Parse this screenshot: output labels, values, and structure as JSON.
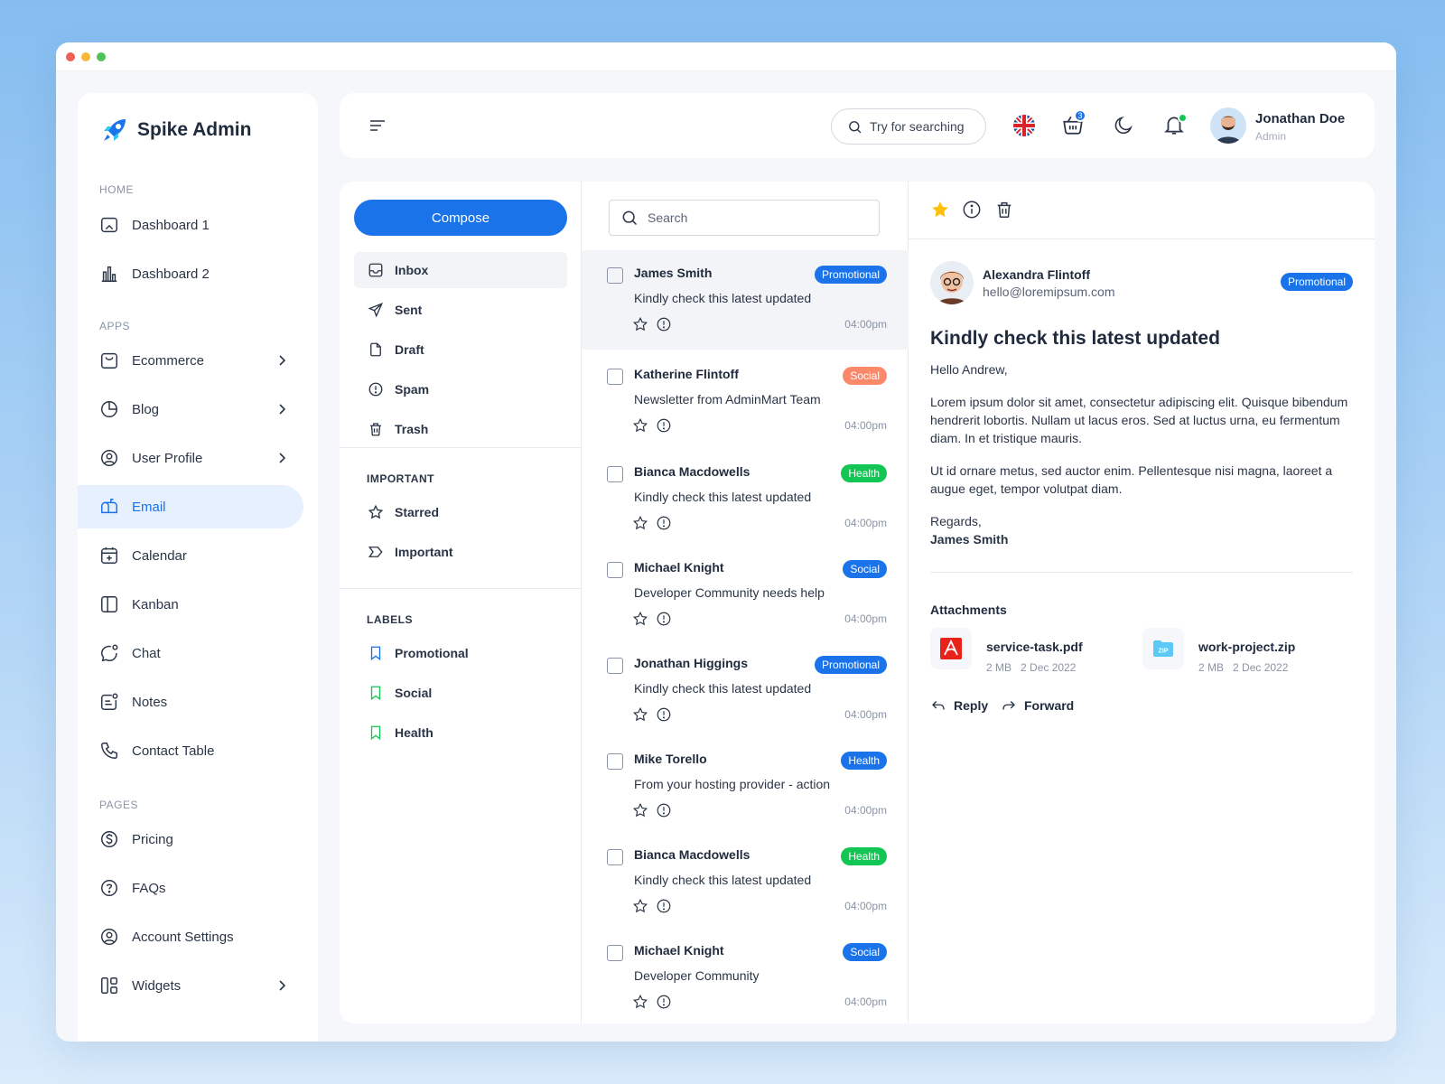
{
  "app": {
    "name": "Spike Admin"
  },
  "colors": {
    "primary": "#1a73e8",
    "social": "#fa896b",
    "health": "#13c654",
    "active_bg": "#e6f0ff",
    "star": "#ffc107"
  },
  "sidebar": {
    "sections": {
      "home": "HOME",
      "apps": "APPS",
      "pages": "PAGES"
    },
    "items": [
      {
        "label": "Dashboard 1",
        "icon": "dashboard-icon"
      },
      {
        "label": "Dashboard 2",
        "icon": "chart-icon"
      },
      {
        "label": "Ecommerce",
        "icon": "basket-icon",
        "has_children": true
      },
      {
        "label": "Blog",
        "icon": "pie-icon",
        "has_children": true
      },
      {
        "label": "User Profile",
        "icon": "user-circle-icon",
        "has_children": true
      },
      {
        "label": "Email",
        "icon": "mailbox-icon",
        "active": true
      },
      {
        "label": "Calendar",
        "icon": "calendar-icon"
      },
      {
        "label": "Kanban",
        "icon": "kanban-icon"
      },
      {
        "label": "Chat",
        "icon": "chat-icon"
      },
      {
        "label": "Notes",
        "icon": "notes-icon"
      },
      {
        "label": "Contact Table",
        "icon": "phone-icon"
      },
      {
        "label": "Pricing",
        "icon": "dollar-icon"
      },
      {
        "label": "FAQs",
        "icon": "question-icon"
      },
      {
        "label": "Account Settings",
        "icon": "user-circle-icon"
      },
      {
        "label": "Widgets",
        "icon": "widgets-icon",
        "has_children": true
      }
    ]
  },
  "header": {
    "search_placeholder": "Try for searching",
    "cart_count": "3",
    "user": {
      "name": "Jonathan Doe",
      "role": "Admin"
    }
  },
  "folders": {
    "compose": "Compose",
    "items": [
      {
        "label": "Inbox",
        "icon": "inbox-icon",
        "active": true
      },
      {
        "label": "Sent",
        "icon": "send-icon"
      },
      {
        "label": "Draft",
        "icon": "file-icon"
      },
      {
        "label": "Spam",
        "icon": "alert-icon"
      },
      {
        "label": "Trash",
        "icon": "trash-icon"
      }
    ],
    "important_title": "IMPORTANT",
    "important": [
      {
        "label": "Starred",
        "icon": "star-icon"
      },
      {
        "label": "Important",
        "icon": "important-icon"
      }
    ],
    "labels_title": "LABELS",
    "labels": [
      {
        "label": "Promotional",
        "color": "#1a73e8"
      },
      {
        "label": "Social",
        "color": "#13c654"
      },
      {
        "label": "Health",
        "color": "#13c654"
      }
    ]
  },
  "mail_list": {
    "search_placeholder": "Search",
    "items": [
      {
        "name": "James Smith",
        "subject": "Kindly check this latest updated",
        "tag": "Promotional",
        "time": "04:00pm",
        "selected": true
      },
      {
        "name": "Katherine Flintoff",
        "subject": "Newsletter from AdminMart Team",
        "tag": "Social",
        "time": "04:00pm",
        "tag_color": "#fa896b"
      },
      {
        "name": "Bianca Macdowells",
        "subject": "Kindly check this latest updated",
        "tag": "Health",
        "time": "04:00pm"
      },
      {
        "name": "Michael Knight",
        "subject": "Developer Community  needs help",
        "tag": "Social",
        "time": "04:00pm",
        "tag_color": "#1a73e8"
      },
      {
        "name": "Jonathan Higgings",
        "subject": "Kindly check this latest updated",
        "tag": "Promotional",
        "time": "04:00pm"
      },
      {
        "name": "Mike Torello",
        "subject": "From your hosting provider - action",
        "tag": "Health",
        "time": "04:00pm",
        "tag_color": "#1a73e8"
      },
      {
        "name": "Bianca Macdowells",
        "subject": "Kindly check this latest updated",
        "tag": "Health",
        "time": "04:00pm",
        "tag_color": "#13c654"
      },
      {
        "name": "Michael Knight",
        "subject": "Developer Community",
        "tag": "Social",
        "time": "04:00pm",
        "tag_color": "#1a73e8"
      }
    ]
  },
  "detail": {
    "sender_name": "Alexandra Flintoff",
    "sender_email": "hello@loremipsum.com",
    "tag": "Promotional",
    "subject": "Kindly check this latest updated",
    "greeting": "Hello Andrew,",
    "para1": "Lorem ipsum dolor sit amet, consectetur adipiscing elit. Quisque bibendum hendrerit lobortis. Nullam ut lacus eros. Sed at luctus urna, eu fermentum diam. In et tristique mauris.",
    "para2": "Ut id ornare metus, sed auctor enim. Pellentesque nisi magna, laoreet a augue eget, tempor volutpat diam.",
    "regards": "Regards,",
    "signature": "James Smith",
    "attachments_title": "Attachments",
    "attachments": [
      {
        "name": "service-task.pdf",
        "size": "2 MB",
        "date": "2 Dec 2022",
        "icon": "pdf-icon"
      },
      {
        "name": "work-project.zip",
        "size": "2 MB",
        "date": "2 Dec 2022",
        "icon": "zip-icon"
      }
    ],
    "reply": "Reply",
    "forward": "Forward"
  }
}
